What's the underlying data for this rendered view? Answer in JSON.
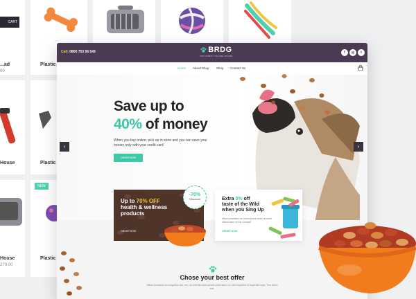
{
  "background": {
    "cart_tag": "CART",
    "tiles": [
      {
        "label": "...ad",
        "price": "00"
      },
      {
        "label": "Plastic",
        "price": ""
      },
      {
        "label": "House",
        "price": ""
      },
      {
        "label": "Plastic",
        "price": ""
      },
      {
        "label": "House",
        "price": "270.00"
      },
      {
        "label": "Plastic",
        "price": ""
      }
    ],
    "new_badge": "NEW"
  },
  "site": {
    "phone_label": "Call",
    "phone": "0800 753 56 543",
    "brand": "BRDG",
    "tagline": "PET'S BEST ONLINE STORE",
    "social": [
      "f",
      "◎",
      "t"
    ]
  },
  "nav": {
    "items": [
      "Home",
      "About Shop",
      "Shop",
      "Contact Us"
    ]
  },
  "hero": {
    "title_line1": "Save up to",
    "title_pct": "40%",
    "title_rest": "of money",
    "description": "When you buy online, pick up in store and you can save your money only with your credit card",
    "button": "ORDER NOW",
    "prev": "‹",
    "next": "›"
  },
  "promo1": {
    "prefix": "Up to ",
    "highlight": "70% OFF",
    "line2": "health & wellness",
    "line3": "products",
    "button": "ORDER NOW",
    "discount_value": "-70%",
    "discount_label": "Discount"
  },
  "promo2": {
    "prefix": "Extra ",
    "highlight": "5%",
    "suffix": " off",
    "line2": "taste of the Wild",
    "line3": "when you Sing Up",
    "description": "Allium proeatum ac lorem ipsum dolor sit amet ullamcorper sit est volutpat.",
    "button": "ORDER NOW"
  },
  "offer": {
    "title": "Chose your best offer",
    "description": "Allium proeatum ac congulora nec, leo, vis deleniti ullam proven pertrulaes; ex, nihil expetere in imperdiet signi. Tuis lorem tum."
  },
  "colors": {
    "accent": "#3fc8a6",
    "header": "#4a3a52",
    "highlight": "#f2c443",
    "bowl": "#f07c1e"
  }
}
